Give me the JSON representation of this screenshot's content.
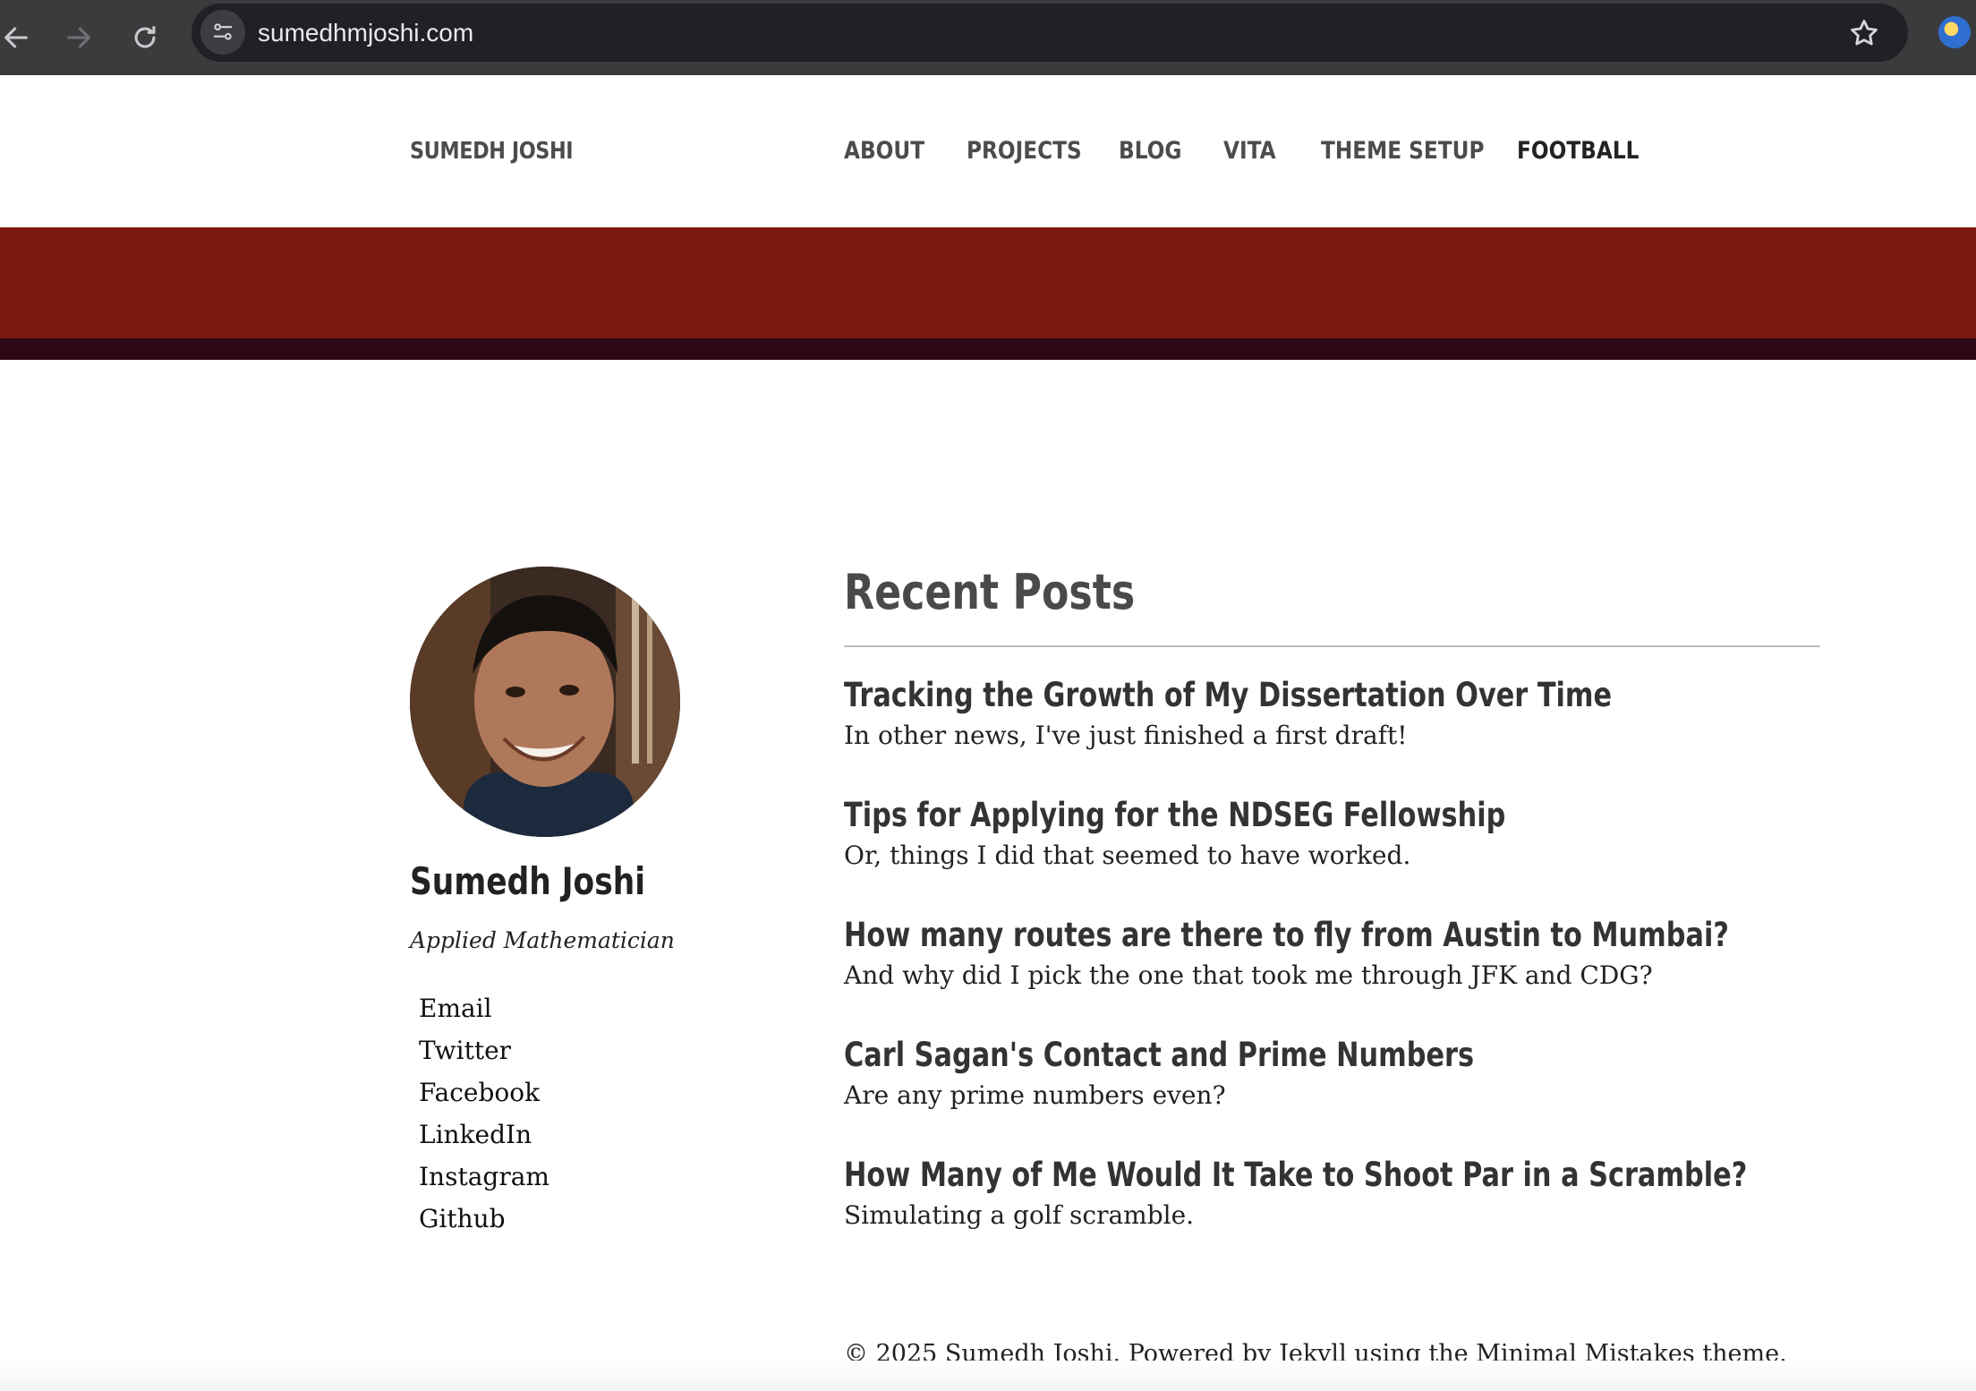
{
  "browser": {
    "url": "sumedhmjoshi.com",
    "icons": [
      "back-arrow-icon",
      "forward-arrow-icon",
      "reload-icon",
      "site-info-icon",
      "bookmark-star-icon",
      "extension-icon"
    ]
  },
  "masthead": {
    "site_title": "SUMEDH JOSHI",
    "nav": [
      {
        "label": "ABOUT"
      },
      {
        "label": "PROJECTS"
      },
      {
        "label": "BLOG"
      },
      {
        "label": "VITA"
      },
      {
        "label": "THEME SETUP"
      },
      {
        "label": "FOOTBALL"
      }
    ]
  },
  "colors": {
    "banner": "#7b1810",
    "banner_strip": "#2e0716"
  },
  "sidebar": {
    "name": "Sumedh Joshi",
    "bio": "Applied Mathematician",
    "links": [
      "Email",
      "Twitter",
      "Facebook",
      "LinkedIn",
      "Instagram",
      "Github"
    ]
  },
  "main": {
    "title": "Recent Posts",
    "posts": [
      {
        "title": "Tracking the Growth of My Dissertation Over Time",
        "excerpt": "In other news, I've just finished a first draft!"
      },
      {
        "title": "Tips for Applying for the NDSEG Fellowship",
        "excerpt": "Or, things I did that seemed to have worked."
      },
      {
        "title": "How many routes are there to fly from Austin to Mumbai?",
        "excerpt": "And why did I pick the one that took me through JFK and CDG?"
      },
      {
        "title": "Carl Sagan's Contact and Prime Numbers",
        "excerpt": "Are any prime numbers even?"
      },
      {
        "title": "How Many of Me Would It Take to Shoot Par in a Scramble?",
        "excerpt": "Simulating a golf scramble."
      }
    ]
  },
  "footer": {
    "text": "© 2025 Sumedh Joshi. Powered by Jekyll using the Minimal Mistakes theme."
  }
}
